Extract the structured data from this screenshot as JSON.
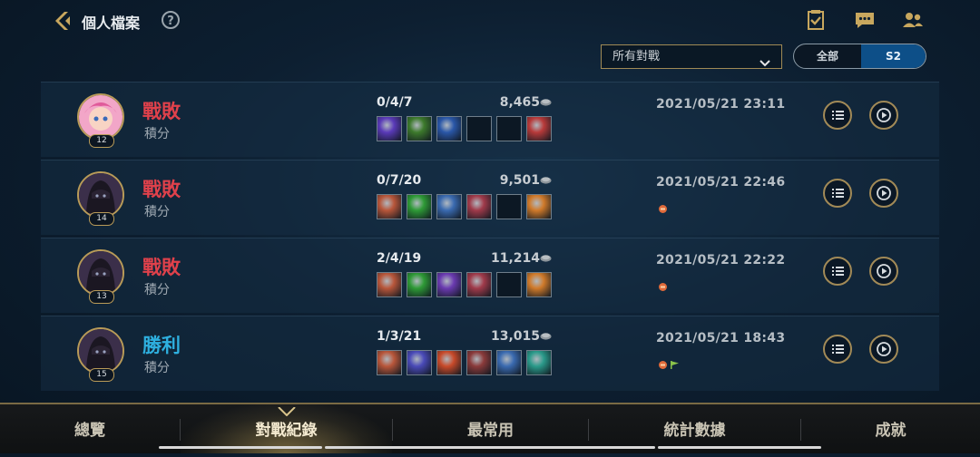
{
  "header": {
    "title": "個人檔案",
    "help": "?"
  },
  "top_icons": [
    "checklist-icon",
    "chat-icon",
    "friends-icon"
  ],
  "filters": {
    "match_type": "所有對戰",
    "season_all": "全部",
    "season_s2": "S2"
  },
  "matches": [
    {
      "result": "戰敗",
      "outcome": "loss",
      "mode": "積分",
      "level": "12",
      "kda": "0/4/7",
      "gold": "8,465",
      "date": "2021/05/21 23:11",
      "champion": "pink-hair-champion",
      "items": [
        "#5a3ab8",
        "#3d7a2c",
        "#2a57a8",
        "empty",
        "empty",
        "#b83a3a"
      ],
      "badges": []
    },
    {
      "result": "戰敗",
      "outcome": "loss",
      "mode": "積分",
      "level": "14",
      "kda": "0/7/20",
      "gold": "9,501",
      "date": "2021/05/21 22:46",
      "champion": "dark-hooded-champion",
      "items": [
        "#b8563a",
        "#2e9a36",
        "#3a6ab0",
        "#a03a4a",
        "empty",
        "#d07a2a"
      ],
      "badges": [
        "orange"
      ]
    },
    {
      "result": "戰敗",
      "outcome": "loss",
      "mode": "積分",
      "level": "13",
      "kda": "2/4/19",
      "gold": "11,214",
      "date": "2021/05/21 22:22",
      "champion": "dark-hooded-champion",
      "items": [
        "#b8563a",
        "#2e9a36",
        "#6a3ab0",
        "#a03a4a",
        "empty",
        "#d07a2a"
      ],
      "badges": [
        "orange"
      ]
    },
    {
      "result": "勝利",
      "outcome": "win",
      "mode": "積分",
      "level": "15",
      "kda": "1/3/21",
      "gold": "13,015",
      "date": "2021/05/21 18:43",
      "champion": "dark-hooded-champion",
      "items": [
        "#b8563a",
        "#4a4ab8",
        "#c84a2a",
        "#8a3a3a",
        "#3a6ab0",
        "#2a9a8a"
      ],
      "badges": [
        "orange",
        "green-flag"
      ]
    }
  ],
  "nav": [
    "總覽",
    "對戰紀錄",
    "最常用",
    "統計數據",
    "成就"
  ],
  "active_nav": "對戰紀錄"
}
